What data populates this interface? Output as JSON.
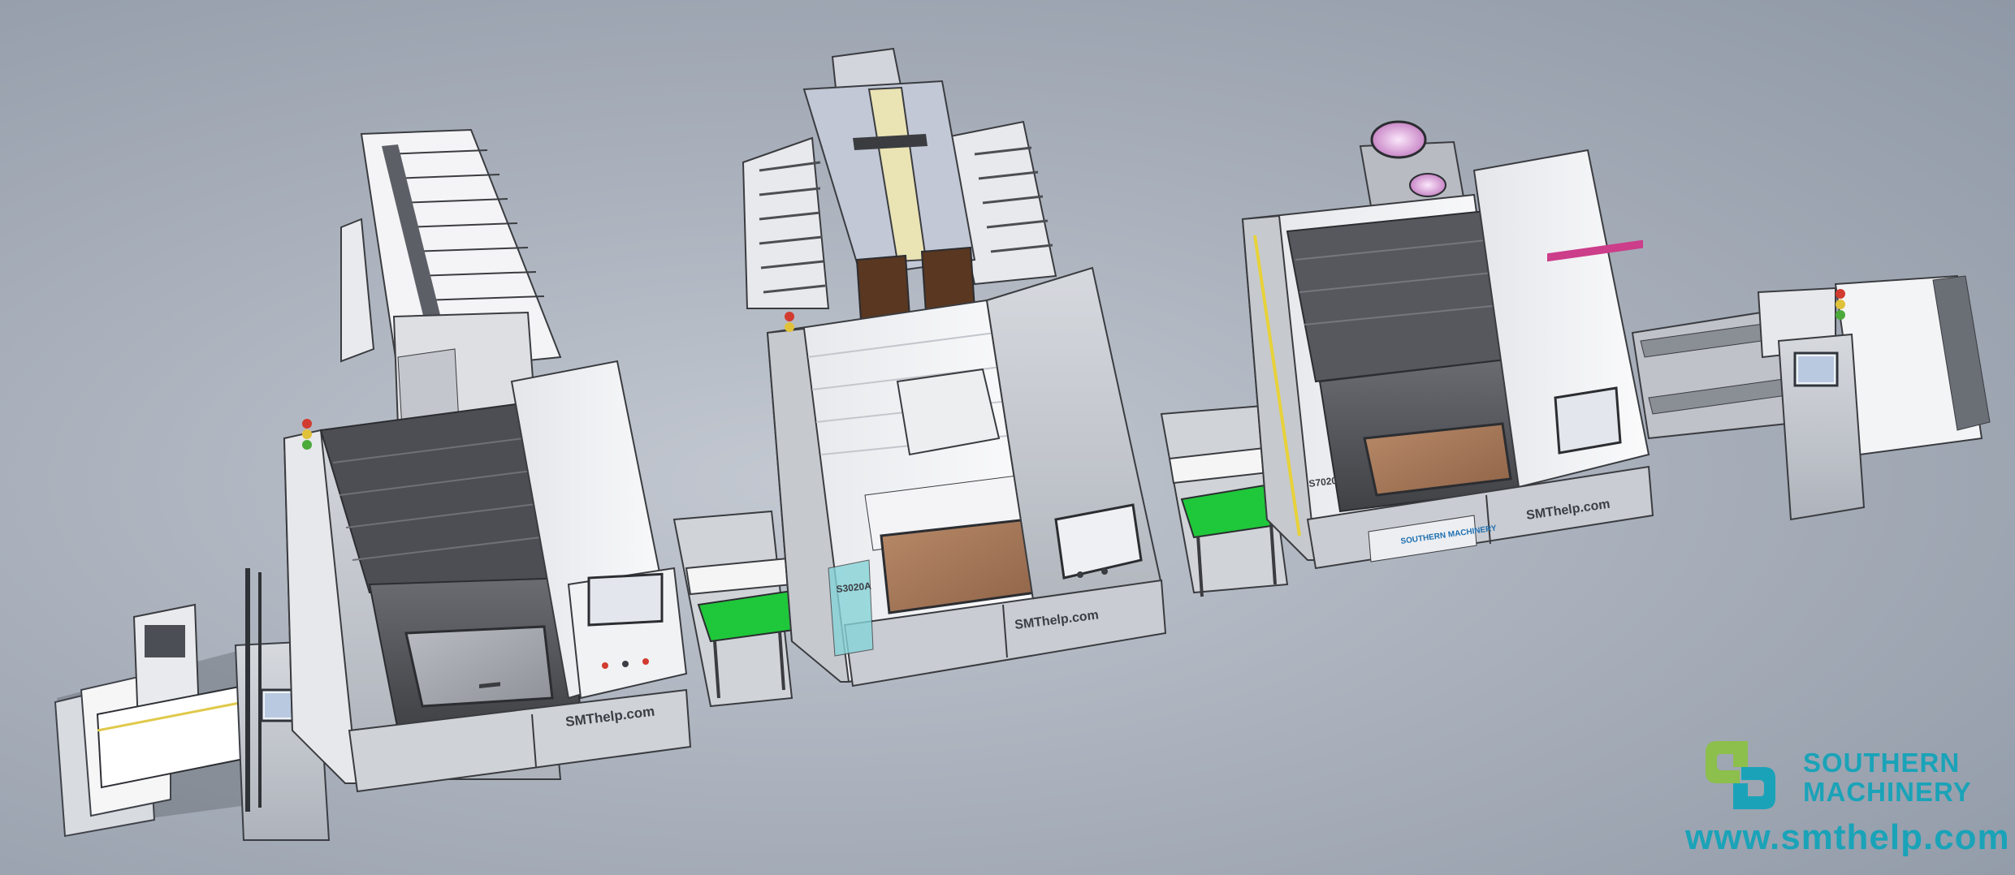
{
  "machines": [
    {
      "id": "loader",
      "label": ""
    },
    {
      "id": "printer",
      "brand": "SMThelp.com"
    },
    {
      "id": "spi",
      "model": "S3020A",
      "brand": "SMThelp.com"
    },
    {
      "id": "conveyor-1"
    },
    {
      "id": "aoi",
      "model": "S7020",
      "brand": "SMThelp.com",
      "logo_text": "SOUTHERN MACHINERY"
    },
    {
      "id": "unloader"
    }
  ],
  "watermark": {
    "line1": "SOUTHERN",
    "line2": "MACHINERY",
    "url": "www.smthelp.com",
    "color": "#1aa3b8",
    "mark_color_left": "#8cbf4b",
    "mark_color_right": "#1aa3b8"
  },
  "colors": {
    "body_white": "#f2f3f5",
    "body_grey": "#c9ccd2",
    "dark_panel": "#55575c",
    "window_brown": "#a9795a",
    "conveyor_green": "#1fc83a",
    "accent_yellow": "#e7d23a",
    "pink_lens": "#e8b6e6"
  }
}
